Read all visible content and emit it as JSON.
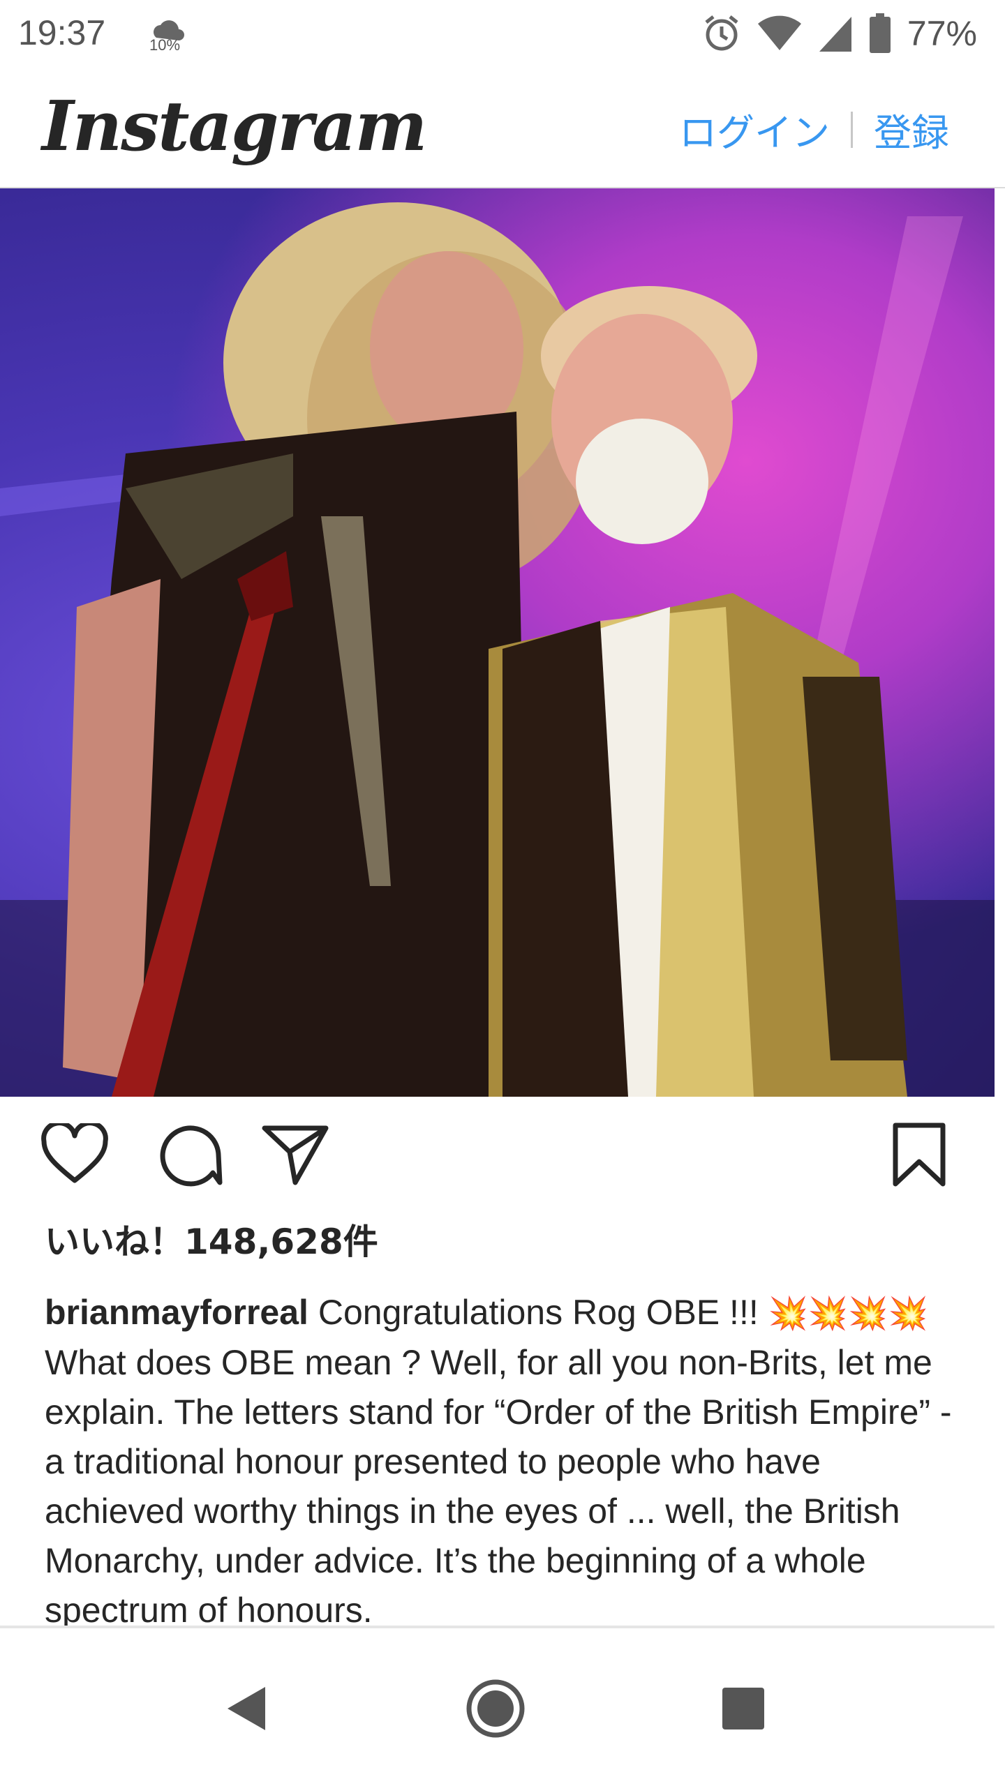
{
  "status_bar": {
    "time": "19:37",
    "weather_percent": "10%",
    "battery_percent": "77%",
    "icons": [
      "cloud-icon",
      "alarm-icon",
      "wifi-icon",
      "signal-icon",
      "battery-icon"
    ]
  },
  "header": {
    "logo": "Instagram",
    "login_label": "ログイン",
    "signup_label": "登録",
    "accent_color": "#3897f0"
  },
  "post": {
    "image": "concert-photo",
    "actions": [
      "heart-icon",
      "comment-icon",
      "share-icon",
      "bookmark-icon"
    ],
    "likes_text": "いいね！148,628件",
    "caption": {
      "username": "brianmayforreal",
      "line1": "Congratulations Rog OBE !!!",
      "burst": "💥💥💥💥",
      "text_after_burst": "What does OBE mean ? Well, for all you non-Brits, let me explain. The letters stand for “Order of the British Empire” - a traditional honour presented to people who have achieved worthy things in the eyes of ... well, the British Monarchy, under advice. It’s the beginning of a whole spectrum of honours."
    }
  },
  "navigation": {
    "buttons": [
      "back-icon",
      "home-icon",
      "recents-icon"
    ]
  }
}
